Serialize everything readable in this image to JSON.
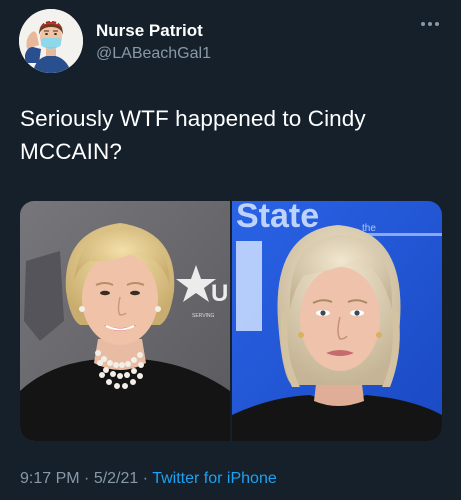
{
  "author": {
    "display_name": "Nurse Patriot",
    "handle": "@LABeachGal1",
    "avatar_icon": "rosie-riveter-nurse-avatar"
  },
  "more_icon": "more-options-icon",
  "tweet": {
    "text": "Seriously WTF happened to Cindy MCCAIN?"
  },
  "media": {
    "left_backdrop_text": "SERVING",
    "right_backdrop_text": "State",
    "right_backdrop_small": "the",
    "colors": {
      "left_bg": "#6d6c71",
      "right_bg": "#1f55d6"
    }
  },
  "meta": {
    "time": "9:17 PM",
    "separator": " · ",
    "date": "5/2/21",
    "separator2": " · ",
    "source": "Twitter for iPhone"
  },
  "colors": {
    "background": "#15202b",
    "secondary_text": "#8899a6",
    "link": "#1da1f2"
  }
}
